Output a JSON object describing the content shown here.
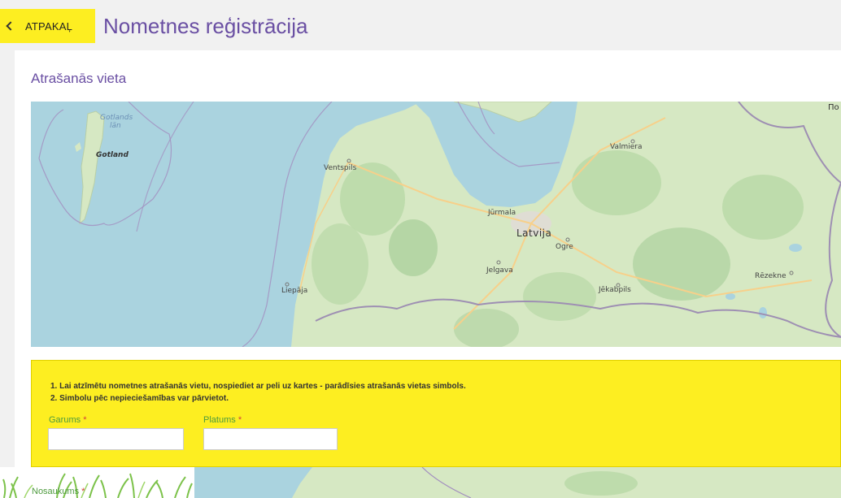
{
  "header": {
    "back_label": "ATPAKAĻ",
    "title": "Nometnes reģistrācija"
  },
  "location": {
    "section_title": "Atrašanās vieta"
  },
  "map": {
    "labels": {
      "gotlands_lan_1": "Gotlands",
      "gotlands_lan_2": "län",
      "gotland": "Gotland",
      "ventspils": "Ventspils",
      "valmiera": "Valmiera",
      "jurmala": "Jūrmala",
      "latvija": "Latvija",
      "ogre": "Ogre",
      "jelgava": "Jelgava",
      "liepaja": "Liepāja",
      "jekabpils": "Jēkabpils",
      "rezekne": "Rēzekne",
      "edge": "По"
    },
    "colors": {
      "sea": "#aad3df",
      "land": "#d6e8c3",
      "forest": "#add19e",
      "border": "#9e8fb3"
    }
  },
  "instructions": {
    "step1": "1.  Lai atzīmētu nometnes atrašanās vietu, nospiediet ar peli uz kartes - parādīsies atrašanās vietas simbols.",
    "step2": "2.  Simbolu pēc nepieciešamības var pārvietot."
  },
  "fields": {
    "longitude_label": "Garums",
    "longitude_value": "",
    "latitude_label": "Platums",
    "latitude_value": "",
    "name_label": "Nosaukums",
    "required_mark": "*"
  },
  "colors": {
    "accent_yellow": "#fdee21",
    "title_purple": "#6a4fa3",
    "label_green": "#4d9a3d",
    "required_red": "#d43f3a"
  }
}
